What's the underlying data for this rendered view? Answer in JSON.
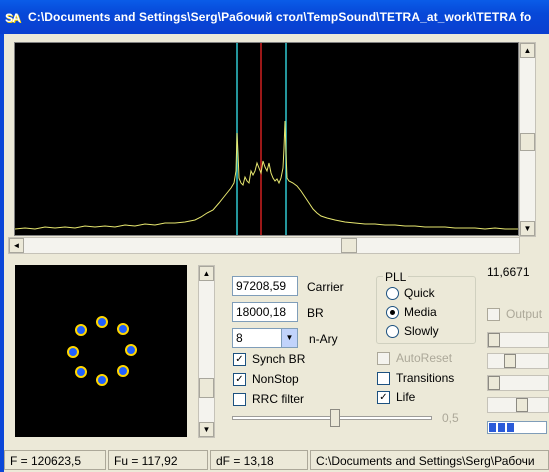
{
  "window": {
    "title": "C:\\Documents and Settings\\Serg\\Рабочий стол\\TempSound\\TETRA_at_work\\TETRA fo",
    "app_icon_text": "SA"
  },
  "controls": {
    "carrier_value": "97208,59",
    "carrier_label": "Carrier",
    "br_value": "18000,18",
    "br_label": "BR",
    "nary_value": "8",
    "nary_label": "n-Ary",
    "synch_br_label": "Synch BR",
    "synch_br_checked": true,
    "nonstop_label": "NonStop",
    "nonstop_checked": true,
    "rrc_filter_label": "RRC filter",
    "rrc_filter_checked": false,
    "autoreset_label": "AutoReset",
    "autoreset_checked": false,
    "transitions_label": "Transitions",
    "transitions_checked": false,
    "life_label": "Life",
    "life_checked": true,
    "filter_slider_value": "0,5"
  },
  "pll": {
    "label": "PLL",
    "options": [
      "Quick",
      "Media",
      "Slowly"
    ],
    "selected": "Media"
  },
  "right_panel": {
    "readout": "11,6671",
    "output_label": "Output",
    "output_checked": false
  },
  "status": {
    "f": "F = 120623,5",
    "fu": "Fu = 117,92",
    "df": "dF = 13,18",
    "path": "C:\\Documents and Settings\\Serg\\Рабочи"
  },
  "colors": {
    "title_bar": "#0a4fde",
    "spectrum_trace": "#e8e870",
    "carrier_marker": "#d02020",
    "band_markers": "#30c8d0",
    "constellation_point": "#2060ff",
    "constellation_ring": "#ffd700"
  },
  "icons": {
    "checked": "✓",
    "scroll_up": "▲",
    "scroll_down": "▼",
    "scroll_left": "◄",
    "scroll_right": "►",
    "dropdown": "▼"
  }
}
